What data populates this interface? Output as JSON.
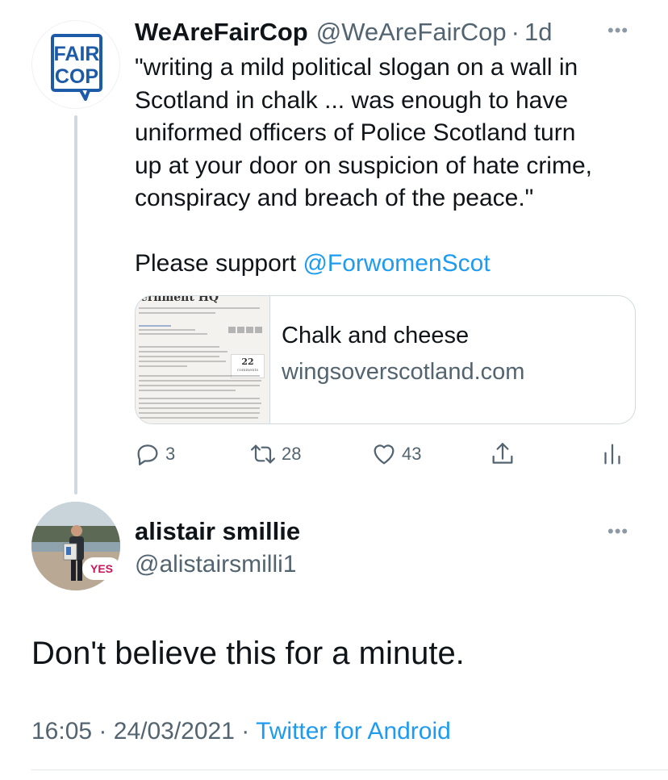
{
  "quoted_tweet": {
    "display_name": "WeAreFairCop",
    "handle": "@WeAreFairCop",
    "separator": "·",
    "age": "1d",
    "avatar_text": [
      "FAIR",
      "COP"
    ],
    "text_lines": [
      "\"writing a mild political slogan on a wall in",
      "Scotland in chalk ... was enough to have",
      "uniformed officers of Police Scotland turn",
      "up at your door on suspicion of hate crime,",
      "conspiracy and breach of the peace.\""
    ],
    "support_prefix": "Please support ",
    "support_mention": "@ForwomenScot",
    "card": {
      "title": "Chalk and cheese",
      "domain": "wingsoverscotland.com",
      "thumb_comment_count": "22",
      "thumb_comment_label": "comments"
    },
    "actions": {
      "replies": "3",
      "retweets": "28",
      "likes": "43"
    }
  },
  "reply_tweet": {
    "display_name": "alistair smillie",
    "handle": "@alistairsmilli1",
    "avatar_badge": "YES",
    "text": "Don't believe this for a minute.",
    "time": "16:05",
    "separator": "·",
    "date": "24/03/2021",
    "source": "Twitter for Android"
  },
  "colors": {
    "link": "#1d9bf0",
    "muted": "#536471",
    "border": "#cfd9de",
    "faircop_blue": "#1d5aa8"
  }
}
